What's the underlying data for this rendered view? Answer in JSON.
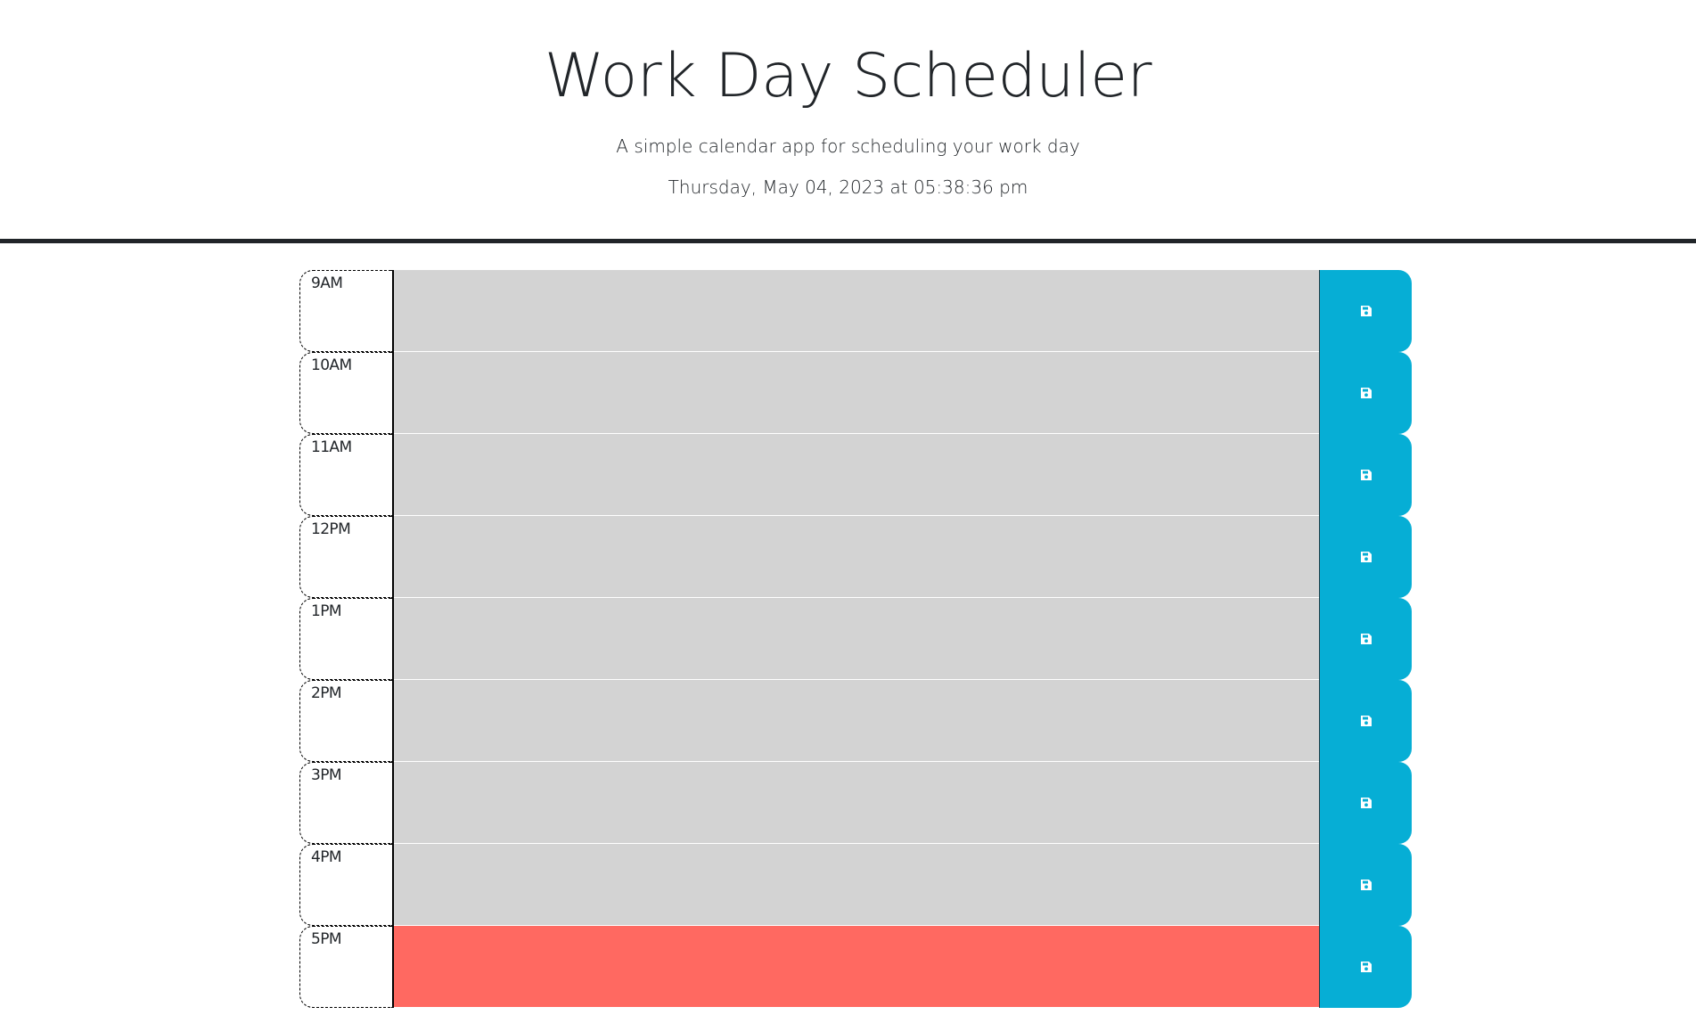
{
  "header": {
    "title": "Work Day Scheduler",
    "subtitle": "A simple calendar app for scheduling your work day",
    "current_datetime": "Thursday, May 04, 2023 at 05:38:36 pm"
  },
  "colors": {
    "past": "#d3d3d3",
    "present": "#ff6961",
    "save_button": "#06aed5"
  },
  "time_blocks": [
    {
      "hour": "9AM",
      "text": "",
      "state": "past"
    },
    {
      "hour": "10AM",
      "text": "",
      "state": "past"
    },
    {
      "hour": "11AM",
      "text": "",
      "state": "past"
    },
    {
      "hour": "12PM",
      "text": "",
      "state": "past"
    },
    {
      "hour": "1PM",
      "text": "",
      "state": "past"
    },
    {
      "hour": "2PM",
      "text": "",
      "state": "past"
    },
    {
      "hour": "3PM",
      "text": "",
      "state": "past"
    },
    {
      "hour": "4PM",
      "text": "",
      "state": "past"
    },
    {
      "hour": "5PM",
      "text": "",
      "state": "present"
    }
  ],
  "icons": {
    "save_button": "save-icon"
  }
}
